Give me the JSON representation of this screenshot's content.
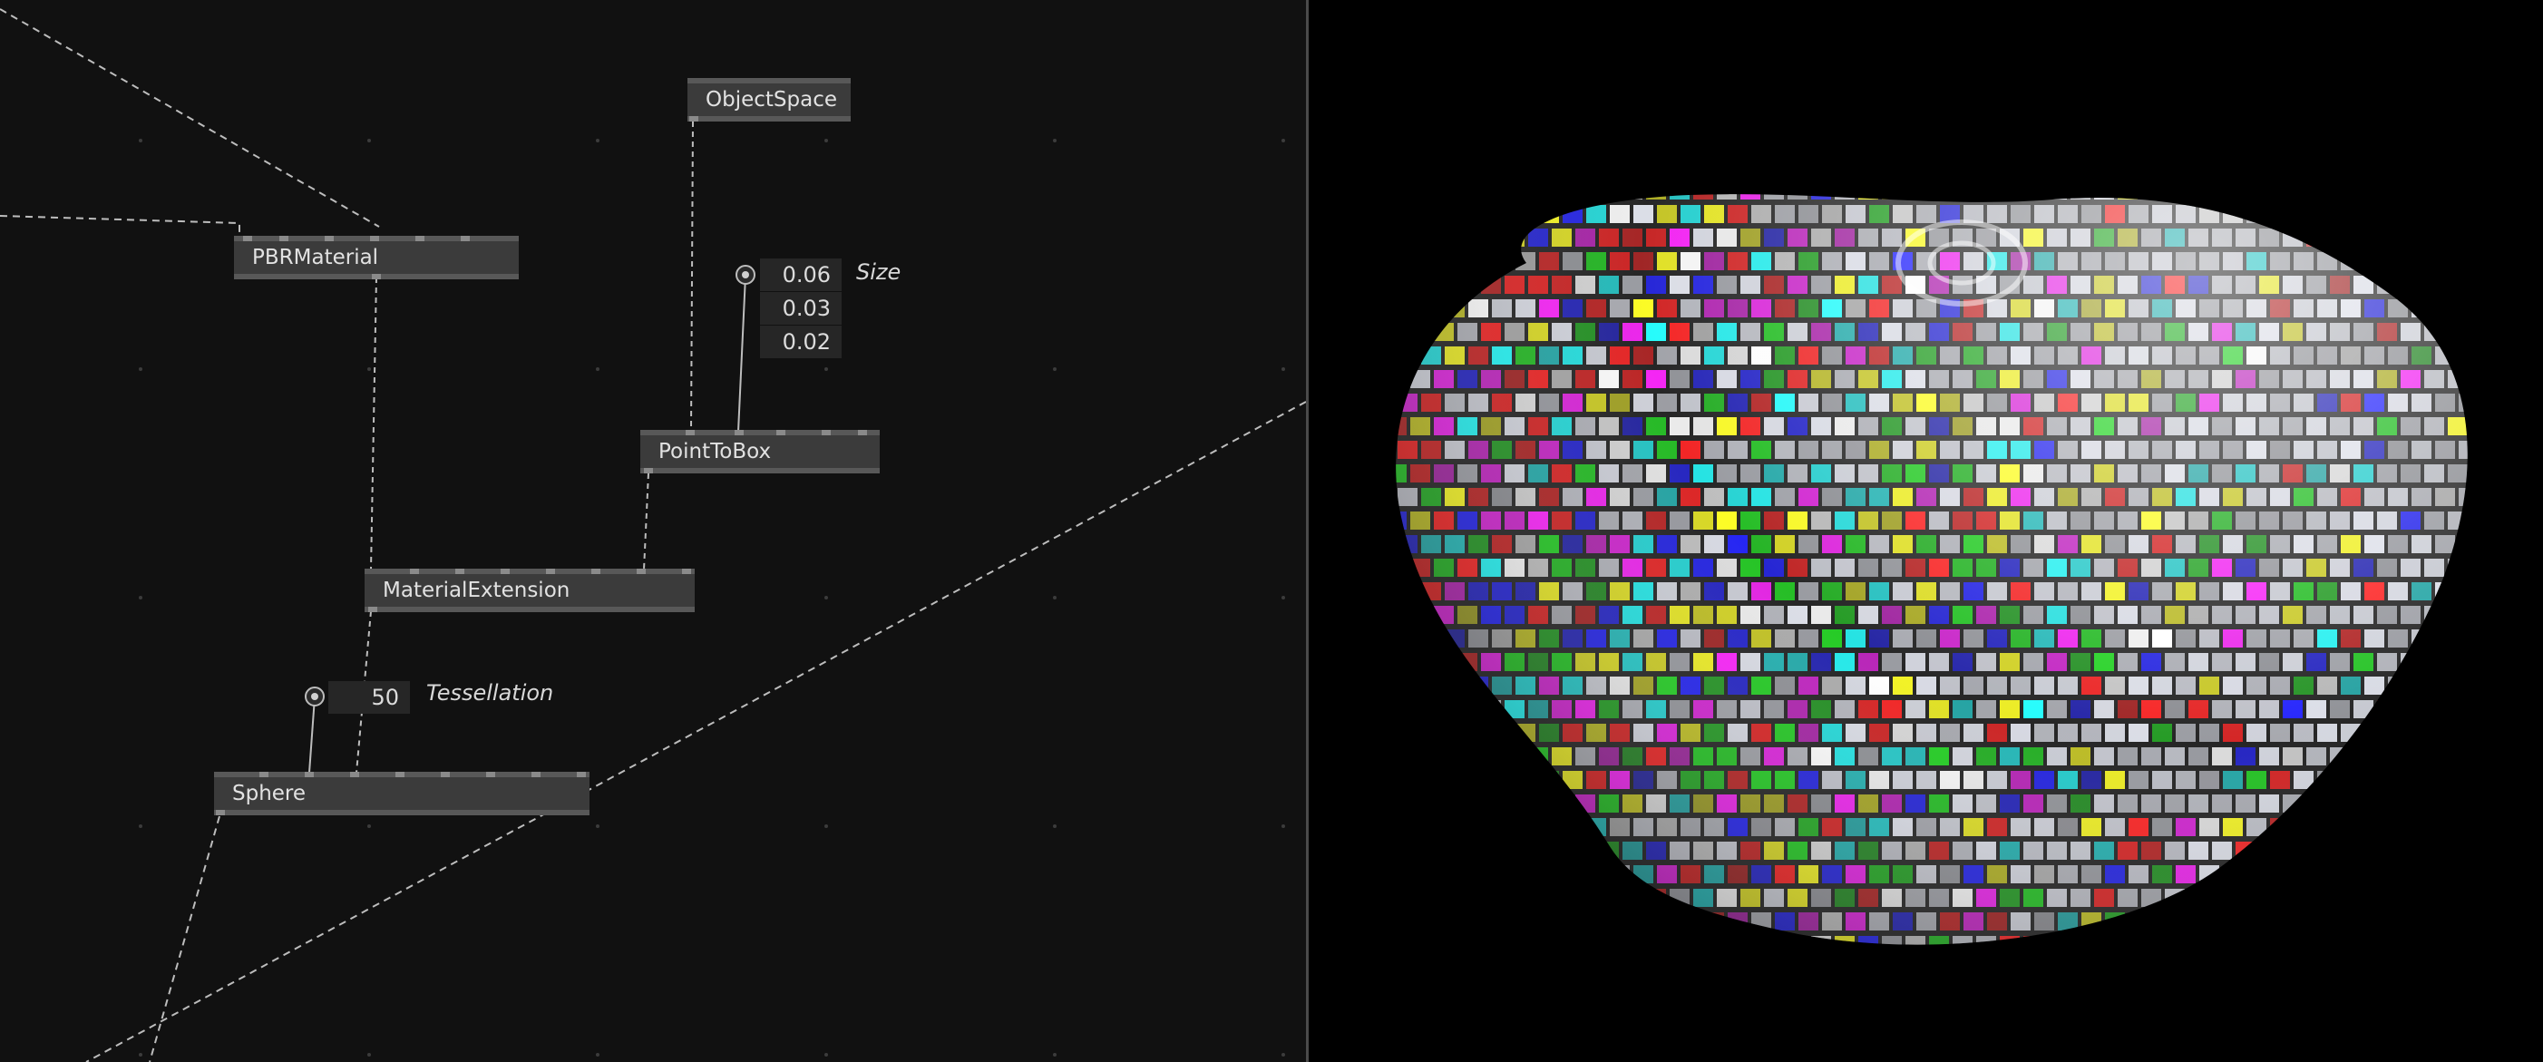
{
  "nodes": {
    "pbr_material": "PBRMaterial",
    "object_space": "ObjectSpace",
    "point_to_box": "PointToBox",
    "material_extension": "MaterialExtension",
    "sphere": "Sphere"
  },
  "size_iobox": {
    "label": "Size",
    "values": [
      "0.06",
      "0.03",
      "0.02"
    ]
  },
  "tessellation_iobox": {
    "label": "Tessellation",
    "value": "50"
  },
  "colors": {
    "editor_bg": "#111111",
    "node_bg": "#3b3b3b",
    "viewport_bg": "#000000"
  },
  "viewport": {
    "content": "voxelized-sphere-render",
    "palette": [
      "#ff0000",
      "#00cc00",
      "#0000ff",
      "#ffff00",
      "#ff00ff",
      "#00ffff",
      "#ffffff"
    ]
  }
}
